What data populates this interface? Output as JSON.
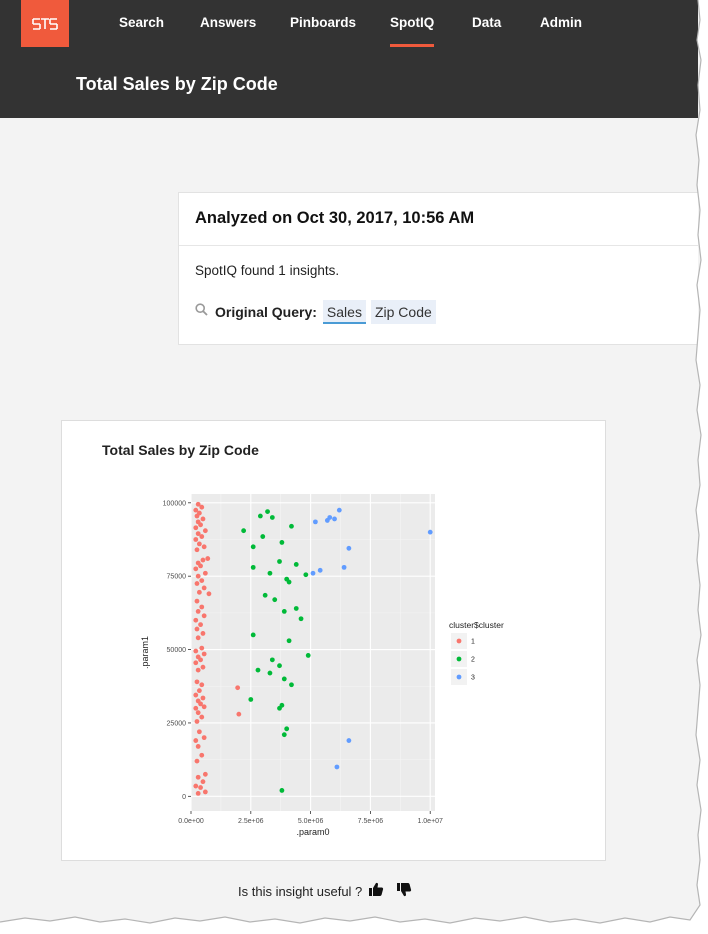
{
  "nav": {
    "items": [
      {
        "label": "Search",
        "active": false
      },
      {
        "label": "Answers",
        "active": false
      },
      {
        "label": "Pinboards",
        "active": false
      },
      {
        "label": "SpotIQ",
        "active": true
      },
      {
        "label": "Data",
        "active": false
      },
      {
        "label": "Admin",
        "active": false
      }
    ]
  },
  "page": {
    "title": "Total Sales by Zip Code"
  },
  "analysis": {
    "header": "Analyzed on Oct 30, 2017, 10:56 AM",
    "found_text": "SpotIQ found 1 insights.",
    "query_label": "Original Query:",
    "query_terms": [
      "Sales",
      "Zip Code"
    ]
  },
  "insight": {
    "title": "Total Sales by Zip Code"
  },
  "chart_data": {
    "type": "scatter",
    "xlabel": ".param0",
    "ylabel": ".param1",
    "xlim": [
      0,
      10200000
    ],
    "ylim": [
      -5000,
      103000
    ],
    "x_ticks": [
      0,
      2500000,
      5000000,
      7500000,
      10000000
    ],
    "x_tick_labels": [
      "0.0e+00",
      "2.5e+06",
      "5.0e+06",
      "7.5e+06",
      "1.0e+07"
    ],
    "y_ticks": [
      0,
      25000,
      50000,
      75000,
      100000
    ],
    "y_tick_labels": [
      "0",
      "25000",
      "50000",
      "75000",
      "100000"
    ],
    "grid": true,
    "legend": {
      "title": "cluster$cluster",
      "position": "right"
    },
    "colors": {
      "1": "#f8766d",
      "2": "#00ba38",
      "3": "#619cff"
    },
    "series": [
      {
        "name": "1",
        "points": [
          [
            300000,
            1000
          ],
          [
            600000,
            1500
          ],
          [
            400000,
            3000
          ],
          [
            200000,
            3500
          ],
          [
            500000,
            5000
          ],
          [
            300000,
            6500
          ],
          [
            600000,
            7500
          ],
          [
            250000,
            12000
          ],
          [
            450000,
            14000
          ],
          [
            300000,
            17000
          ],
          [
            200000,
            19000
          ],
          [
            550000,
            20000
          ],
          [
            350000,
            22000
          ],
          [
            250000,
            25500
          ],
          [
            450000,
            27000
          ],
          [
            300000,
            28500
          ],
          [
            200000,
            30000
          ],
          [
            550000,
            30500
          ],
          [
            400000,
            31500
          ],
          [
            300000,
            32500
          ],
          [
            500000,
            33500
          ],
          [
            200000,
            34500
          ],
          [
            350000,
            36000
          ],
          [
            450000,
            38000
          ],
          [
            250000,
            39000
          ],
          [
            300000,
            43000
          ],
          [
            500000,
            44000
          ],
          [
            200000,
            45500
          ],
          [
            400000,
            46500
          ],
          [
            300000,
            47500
          ],
          [
            550000,
            48500
          ],
          [
            200000,
            49500
          ],
          [
            450000,
            50500
          ],
          [
            300000,
            54000
          ],
          [
            500000,
            55500
          ],
          [
            250000,
            57000
          ],
          [
            400000,
            58500
          ],
          [
            200000,
            60000
          ],
          [
            550000,
            61500
          ],
          [
            300000,
            63000
          ],
          [
            450000,
            64500
          ],
          [
            250000,
            66500
          ],
          [
            350000,
            69500
          ],
          [
            550000,
            71000
          ],
          [
            250000,
            72500
          ],
          [
            450000,
            73500
          ],
          [
            300000,
            75000
          ],
          [
            600000,
            76000
          ],
          [
            200000,
            77500
          ],
          [
            400000,
            78500
          ],
          [
            300000,
            79500
          ],
          [
            500000,
            80500
          ],
          [
            250000,
            84000
          ],
          [
            550000,
            85000
          ],
          [
            350000,
            86000
          ],
          [
            200000,
            87500
          ],
          [
            450000,
            88500
          ],
          [
            300000,
            89500
          ],
          [
            600000,
            90500
          ],
          [
            200000,
            91500
          ],
          [
            400000,
            92500
          ],
          [
            300000,
            93500
          ],
          [
            500000,
            94500
          ],
          [
            250000,
            95500
          ],
          [
            350000,
            96500
          ],
          [
            200000,
            97500
          ],
          [
            450000,
            98500
          ],
          [
            300000,
            99500
          ],
          [
            750000,
            69000
          ],
          [
            700000,
            81000
          ],
          [
            1950000,
            37000
          ],
          [
            2000000,
            28000
          ]
        ]
      },
      {
        "name": "2",
        "points": [
          [
            3200000,
            97000
          ],
          [
            3400000,
            95000
          ],
          [
            2900000,
            95500
          ],
          [
            3800000,
            86500
          ],
          [
            2200000,
            90500
          ],
          [
            4200000,
            92000
          ],
          [
            3000000,
            88500
          ],
          [
            2600000,
            85000
          ],
          [
            3700000,
            80000
          ],
          [
            4400000,
            79000
          ],
          [
            3300000,
            76000
          ],
          [
            2600000,
            78000
          ],
          [
            4800000,
            75500
          ],
          [
            4000000,
            74000
          ],
          [
            4100000,
            73000
          ],
          [
            3100000,
            68500
          ],
          [
            3500000,
            67000
          ],
          [
            4400000,
            64000
          ],
          [
            3900000,
            63000
          ],
          [
            4600000,
            60500
          ],
          [
            2600000,
            55000
          ],
          [
            4100000,
            53000
          ],
          [
            4900000,
            48000
          ],
          [
            3400000,
            46500
          ],
          [
            3700000,
            44500
          ],
          [
            2800000,
            43000
          ],
          [
            3900000,
            40000
          ],
          [
            4200000,
            38000
          ],
          [
            3300000,
            42000
          ],
          [
            2500000,
            33000
          ],
          [
            3800000,
            31000
          ],
          [
            3700000,
            30000
          ],
          [
            4000000,
            23000
          ],
          [
            3900000,
            21000
          ],
          [
            3800000,
            2000
          ]
        ]
      },
      {
        "name": "3",
        "points": [
          [
            6200000,
            97500
          ],
          [
            5800000,
            95000
          ],
          [
            5700000,
            94000
          ],
          [
            5200000,
            93500
          ],
          [
            6000000,
            94500
          ],
          [
            6600000,
            84500
          ],
          [
            10000000,
            90000
          ],
          [
            6400000,
            78000
          ],
          [
            5400000,
            77000
          ],
          [
            5100000,
            76000
          ],
          [
            6600000,
            19000
          ],
          [
            6100000,
            10000
          ]
        ]
      }
    ]
  },
  "feedback": {
    "question": "Is this insight useful ?"
  }
}
